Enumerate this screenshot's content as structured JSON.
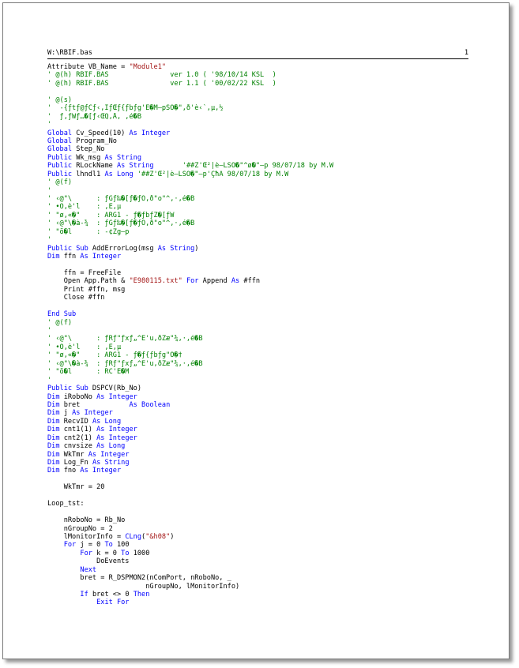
{
  "header": {
    "filename": "W:\\RBIF.bas",
    "page_number": "1"
  },
  "colors": {
    "keyword": "#0000ff",
    "comment": "#008000",
    "string": "#a31515",
    "plain": "#000000"
  },
  "lines": [
    [
      [
        "p",
        "Attribute VB_Name = "
      ],
      [
        "s",
        "\"Module1\""
      ]
    ],
    [
      [
        "c",
        "' @(h) RBIF.BAS               ver 1.0 ( '98/10/14 KSL  )"
      ]
    ],
    [
      [
        "c",
        "' @(h) RBIF.BAS               ver 1.1 ( '00/02/22 KSL  )"
      ]
    ],
    [],
    [
      [
        "c",
        "' @(s)"
      ]
    ],
    [
      [
        "c",
        "'  -{ƒtƒ@ƒCƒ‹,ÎƒŒƒ{ƒbƒg'Ê�M—pŠÖ�\",ð'è‹`,µ,½"
      ]
    ],
    [
      [
        "c",
        "'  ƒ,ƒWƒ…�[ƒ‹ŒQ,Å, ,é�B"
      ]
    ],
    [
      [
        "c",
        "'"
      ]
    ],
    [
      [
        "k",
        "Global"
      ],
      [
        "p",
        " Cv_Speed(10) "
      ],
      [
        "k",
        "As Integer"
      ]
    ],
    [
      [
        "k",
        "Global"
      ],
      [
        "p",
        " Program_No"
      ]
    ],
    [
      [
        "k",
        "Global"
      ],
      [
        "p",
        " Step_No"
      ]
    ],
    [
      [
        "k",
        "Public"
      ],
      [
        "p",
        " Wk_msg "
      ],
      [
        "k",
        "As String"
      ]
    ],
    [
      [
        "k",
        "Public"
      ],
      [
        "p",
        " RLockName "
      ],
      [
        "k",
        "As String"
      ],
      [
        "c",
        "       '##Ž'Œ²|è—LŠÖ�\"^ø�\"—p 98/07/18 by M.W"
      ]
    ],
    [
      [
        "k",
        "Public"
      ],
      [
        "p",
        " lhndl1 "
      ],
      [
        "k",
        "As Long"
      ],
      [
        "c",
        " '##Ž'Œ²|è—LŠÖ�\"—p'ÇħÁ 98/07/18 by M.W"
      ]
    ],
    [
      [
        "c",
        "' @(f)"
      ]
    ],
    [
      [
        "c",
        "'"
      ]
    ],
    [
      [
        "c",
        "' ‹@\"\\      : ƒGƒ‰�[ƒ�ƒO,ð\"o\"^,·,é�B"
      ]
    ],
    [
      [
        "c",
        "' •Ô,è'l    : ,È,µ"
      ]
    ],
    [
      [
        "c",
        "' \"ø,«�\"    : ARG1 - ƒ�ƒbƒZ�[ƒW"
      ]
    ],
    [
      [
        "c",
        "' ‹@\"\\�à-¾  : ƒGƒ‰�[ƒ�ƒO,ð\"o\"^,·,é�B"
      ]
    ],
    [
      [
        "c",
        "' \"õ�l      : -¢Žg—p"
      ]
    ],
    [
      [
        "c",
        "'"
      ]
    ],
    [
      [
        "k",
        "Public Sub"
      ],
      [
        "p",
        " AddErrorLog(msg "
      ],
      [
        "k",
        "As String"
      ],
      [
        "p",
        ")"
      ]
    ],
    [
      [
        "k",
        "Dim"
      ],
      [
        "p",
        " ffn "
      ],
      [
        "k",
        "As Integer"
      ]
    ],
    [],
    [
      [
        "p",
        "    ffn = FreeFile"
      ]
    ],
    [
      [
        "p",
        "    Open App.Path & "
      ],
      [
        "s",
        "\"E980115.txt\""
      ],
      [
        "p",
        " "
      ],
      [
        "k",
        "For"
      ],
      [
        "p",
        " Append "
      ],
      [
        "k",
        "As"
      ],
      [
        "p",
        " #ffn"
      ]
    ],
    [
      [
        "p",
        "    Print #ffn, msg"
      ]
    ],
    [
      [
        "p",
        "    Close #ffn"
      ]
    ],
    [],
    [
      [
        "k",
        "End Sub"
      ]
    ],
    [
      [
        "c",
        "' @(f)"
      ]
    ],
    [
      [
        "c",
        "'"
      ]
    ],
    [
      [
        "c",
        "' ‹@\"\\      : ƒRƒ\"ƒxƒ„^Ê'u,ðŽæ\"¾,·,é�B"
      ]
    ],
    [
      [
        "c",
        "' •Ô,è'l    : ,È,µ"
      ]
    ],
    [
      [
        "c",
        "' \"ø,«�\"    : ARG1 - ƒ�ƒ{ƒbƒg\"Ô�†"
      ]
    ],
    [
      [
        "c",
        "' ‹@\"\\�à-¾  : ƒRƒ\"ƒxƒ„^Ê'u,ðŽæ\"¾,·,é�B"
      ]
    ],
    [
      [
        "c",
        "' \"õ�l      : RC'Ê�M"
      ]
    ],
    [
      [
        "c",
        "'"
      ]
    ],
    [
      [
        "k",
        "Public Sub"
      ],
      [
        "p",
        " DSPCV(Rb_No)"
      ]
    ],
    [
      [
        "k",
        "Dim"
      ],
      [
        "p",
        " iRoboNo "
      ],
      [
        "k",
        "As Integer"
      ]
    ],
    [
      [
        "k",
        "Dim"
      ],
      [
        "p",
        " bret            "
      ],
      [
        "k",
        "As Boolean"
      ]
    ],
    [
      [
        "k",
        "Dim"
      ],
      [
        "p",
        " j "
      ],
      [
        "k",
        "As Integer"
      ]
    ],
    [
      [
        "k",
        "Dim"
      ],
      [
        "p",
        " RecvID "
      ],
      [
        "k",
        "As Long"
      ]
    ],
    [
      [
        "k",
        "Dim"
      ],
      [
        "p",
        " cnt1(1) "
      ],
      [
        "k",
        "As Integer"
      ]
    ],
    [
      [
        "k",
        "Dim"
      ],
      [
        "p",
        " cnt2(1) "
      ],
      [
        "k",
        "As Integer"
      ]
    ],
    [
      [
        "k",
        "Dim"
      ],
      [
        "p",
        " cnvsize "
      ],
      [
        "k",
        "As Long"
      ]
    ],
    [
      [
        "k",
        "Dim"
      ],
      [
        "p",
        " WkTmr "
      ],
      [
        "k",
        "As Integer"
      ]
    ],
    [
      [
        "k",
        "Dim"
      ],
      [
        "p",
        " Log_Fn "
      ],
      [
        "k",
        "As String"
      ]
    ],
    [
      [
        "k",
        "Dim"
      ],
      [
        "p",
        " fno "
      ],
      [
        "k",
        "As Integer"
      ]
    ],
    [],
    [
      [
        "p",
        "    WkTmr = 20"
      ]
    ],
    [],
    [
      [
        "p",
        "Loop_tst:"
      ]
    ],
    [],
    [
      [
        "p",
        "    nRoboNo = Rb_No"
      ]
    ],
    [
      [
        "p",
        "    nGroupNo = 2"
      ]
    ],
    [
      [
        "p",
        "    lMonitorInfo = "
      ],
      [
        "k",
        "CLng"
      ],
      [
        "p",
        "("
      ],
      [
        "s",
        "\"&h08\""
      ],
      [
        "p",
        ")"
      ]
    ],
    [
      [
        "p",
        "    "
      ],
      [
        "k",
        "For"
      ],
      [
        "p",
        " j = 0 "
      ],
      [
        "k",
        "To"
      ],
      [
        "p",
        " 100"
      ]
    ],
    [
      [
        "p",
        "        "
      ],
      [
        "k",
        "For"
      ],
      [
        "p",
        " k = 0 "
      ],
      [
        "k",
        "To"
      ],
      [
        "p",
        " 1000"
      ]
    ],
    [
      [
        "p",
        "            DoEvents"
      ]
    ],
    [
      [
        "p",
        "        "
      ],
      [
        "k",
        "Next"
      ]
    ],
    [
      [
        "p",
        "        bret = R_DSPMON2(nComPort, nRoboNo, _"
      ]
    ],
    [
      [
        "p",
        "                        nGroupNo, lMonitorInfo)"
      ]
    ],
    [
      [
        "p",
        "        "
      ],
      [
        "k",
        "If"
      ],
      [
        "p",
        " bret <> 0 "
      ],
      [
        "k",
        "Then"
      ]
    ],
    [
      [
        "p",
        "            "
      ],
      [
        "k",
        "Exit For"
      ]
    ]
  ]
}
